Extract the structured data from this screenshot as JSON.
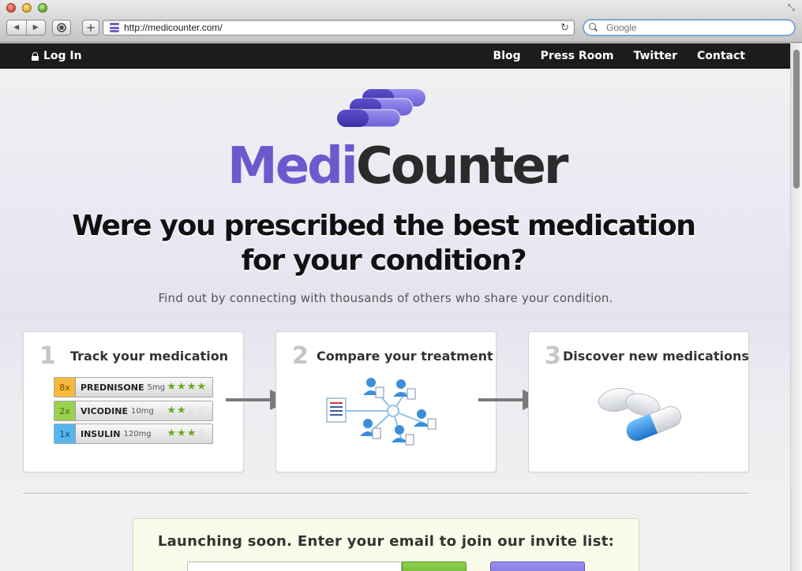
{
  "browser": {
    "url": "http://medicounter.com/",
    "search_placeholder": "Google"
  },
  "topbar": {
    "login_label": "Log In",
    "nav": [
      "Blog",
      "Press Room",
      "Twitter",
      "Contact"
    ]
  },
  "brand": {
    "medi": "Medi",
    "counter": "Counter",
    "colors": {
      "medi": "#6a5acd",
      "counter": "#2b2b2b",
      "accent_green": "#6aab1e",
      "accent_blue": "#3b9be0"
    }
  },
  "hero": {
    "headline_line1": "Were you prescribed the best medication",
    "headline_line2": "for your condition?",
    "subline": "Find out by connecting with thousands of others who share your condition."
  },
  "steps": [
    {
      "num": "1",
      "title": "Track your medication"
    },
    {
      "num": "2",
      "title": "Compare your treatment"
    },
    {
      "num": "3",
      "title": "Discover new medications"
    }
  ],
  "medications": [
    {
      "count": "8x",
      "name": "PREDNISONE",
      "dose": "5mg",
      "rating": 4,
      "color": "#f6b93b"
    },
    {
      "count": "2x",
      "name": "VICODINE",
      "dose": "10mg",
      "rating": 2,
      "color": "#9ad14f"
    },
    {
      "count": "1x",
      "name": "INSULIN",
      "dose": "120mg",
      "rating": 3,
      "color": "#55b6ee"
    }
  ],
  "invite": {
    "text": "Launching soon. Enter your email to join our invite list:"
  }
}
